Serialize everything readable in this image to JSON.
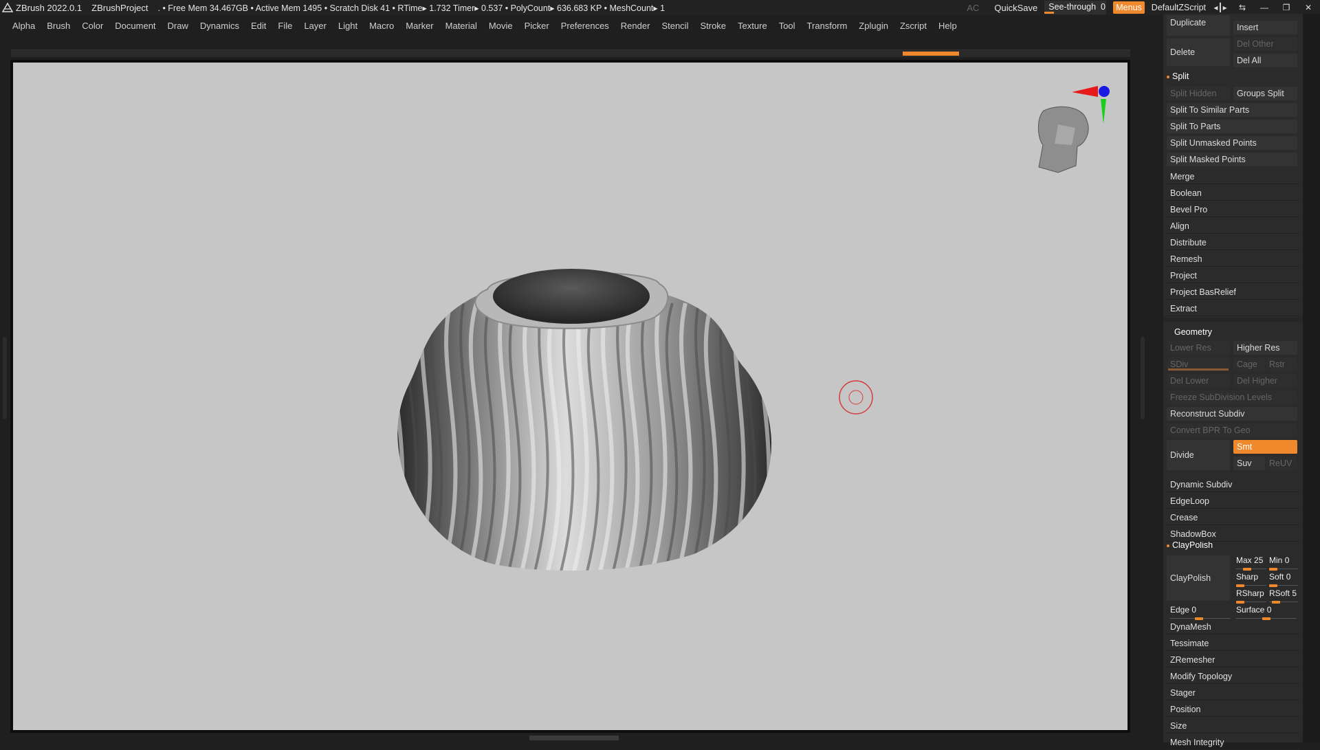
{
  "titlebar": {
    "app": "ZBrush 2022.0.1",
    "project": "ZBrushProject",
    "stats": ". • Free Mem 34.467GB • Active Mem 1495 • Scratch Disk 41 • RTime▸ 1.732 Timer▸ 0.537 • PolyCount▸ 636.683 KP • MeshCount▸ 1",
    "ac": "AC",
    "quicksave": "QuickSave",
    "seethrough_label": "See-through",
    "seethrough_value": "0",
    "seethrough_level": 0,
    "menus": "Menus",
    "script": "DefaultZScript",
    "icons": [
      "layout-arrows-icon",
      "layout-swap-icon",
      "minimize-icon",
      "restore-icon",
      "close-icon"
    ]
  },
  "menubar": [
    "Alpha",
    "Brush",
    "Color",
    "Document",
    "Draw",
    "Dynamics",
    "Edit",
    "File",
    "Layer",
    "Light",
    "Macro",
    "Marker",
    "Material",
    "Movie",
    "Picker",
    "Preferences",
    "Render",
    "Stencil",
    "Stroke",
    "Texture",
    "Tool",
    "Transform",
    "Zplugin",
    "Zscript",
    "Help"
  ],
  "colors": {
    "accent": "#f0882c",
    "viewport": "#c6c6c6",
    "panel": "#262626"
  },
  "panel": {
    "subtool": {
      "duplicate": "Duplicate",
      "insert": "Insert",
      "delete": "Delete",
      "del_other": "Del Other",
      "del_all": "Del All"
    },
    "split": {
      "title": "Split",
      "split_hidden": "Split Hidden",
      "groups_split": "Groups Split",
      "items": [
        "Split To Similar Parts",
        "Split To Parts",
        "Split Unmasked Points",
        "Split Masked Points"
      ]
    },
    "list1": [
      "Merge",
      "Boolean",
      "Bevel Pro",
      "Align",
      "Distribute",
      "Remesh",
      "Project",
      "Project BasRelief",
      "Extract"
    ],
    "geometry": {
      "title": "Geometry",
      "lower_res": "Lower Res",
      "higher_res": "Higher Res",
      "sdiv": "SDiv",
      "cage": "Cage",
      "rstr": "Rstr",
      "del_lower": "Del Lower",
      "del_higher": "Del Higher",
      "freeze": "Freeze SubDivision Levels",
      "reconstruct": "Reconstruct Subdiv",
      "convert": "Convert BPR To Geo",
      "divide": "Divide",
      "smt": "Smt",
      "suv": "Suv",
      "reuv": "ReUV"
    },
    "list2": [
      "Dynamic Subdiv",
      "EdgeLoop",
      "Crease",
      "ShadowBox"
    ],
    "claypolish": {
      "title": "ClayPolish",
      "button": "ClayPolish",
      "max_label": "Max",
      "max": "25",
      "min_label": "Min",
      "min": "0",
      "sharp_label": "Sharp",
      "soft_label": "Soft",
      "soft": "0",
      "rsharp_label": "RSharp",
      "rsoft_label": "RSoft",
      "rsoft": "5",
      "edge_label": "Edge",
      "edge": "0",
      "surface_label": "Surface",
      "surface": "0"
    },
    "list3": [
      "DynaMesh",
      "Tessimate",
      "ZRemesher",
      "Modify Topology",
      "Stager",
      "Position",
      "Size",
      "Mesh Integrity"
    ]
  }
}
